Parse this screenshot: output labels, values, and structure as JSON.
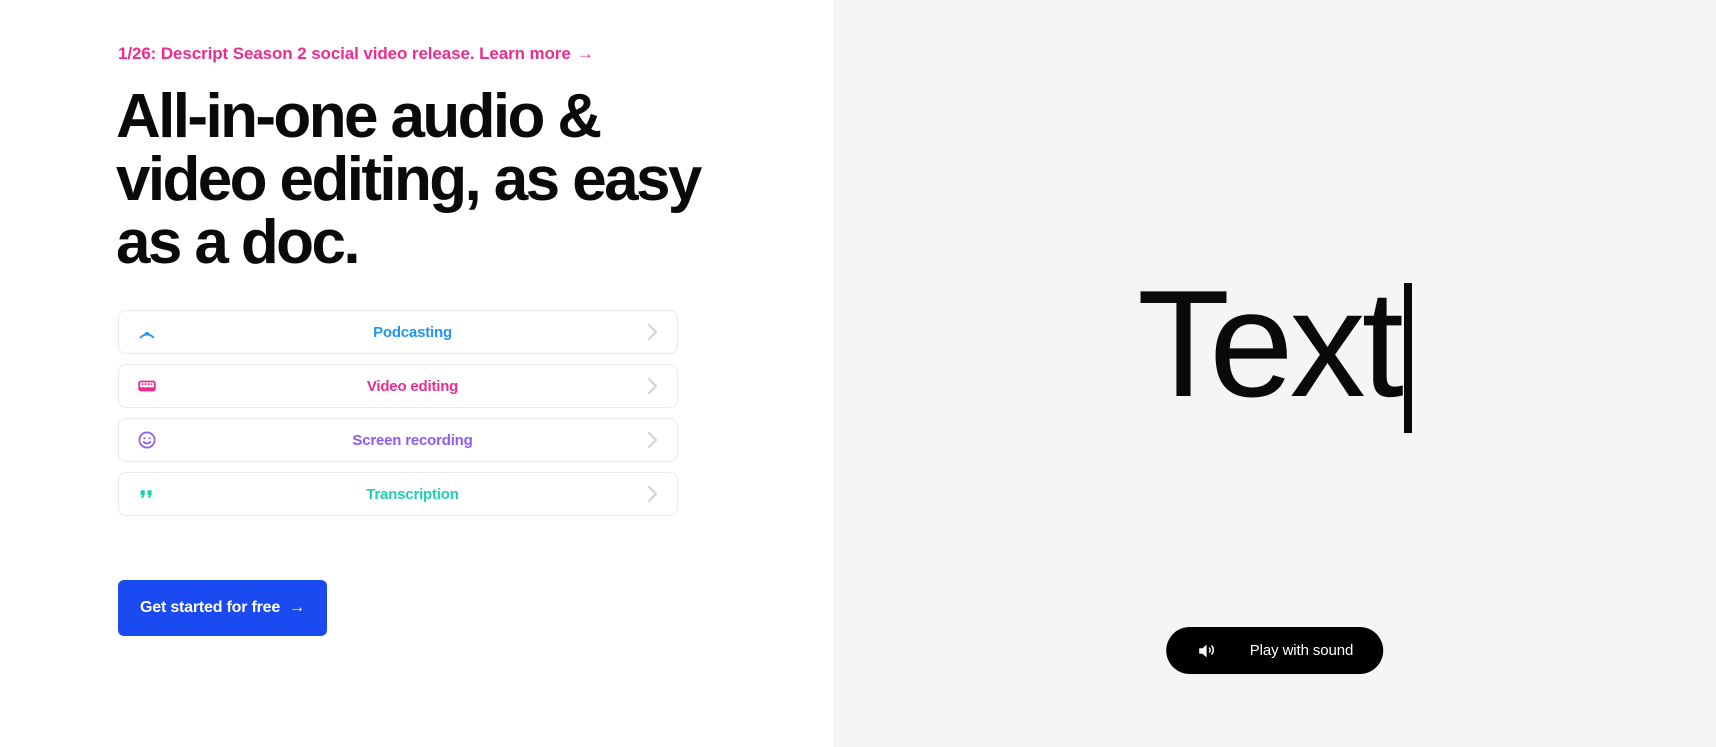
{
  "announcement": {
    "text": "1/26: Descript Season 2 social video release. Learn more",
    "arrow": "→",
    "color": "#EC2C8F"
  },
  "headline": "All-in-one audio & video editing, as easy as a doc.",
  "features": [
    {
      "label": "Podcasting",
      "color": "#2196F3",
      "icon": "podcast-icon"
    },
    {
      "label": "Video editing",
      "color": "#EC2C8F",
      "icon": "film-strip-icon"
    },
    {
      "label": "Screen recording",
      "color": "#8B5CF6",
      "icon": "smiley-face-icon"
    },
    {
      "label": "Transcription",
      "color": "#1ECFB0",
      "icon": "quote-marks-icon"
    }
  ],
  "cta": {
    "label": "Get started for free",
    "arrow": "→",
    "color": "#1B4AF0"
  },
  "preview": {
    "word": "Text",
    "caret": "|",
    "background": "#F5F5F5"
  },
  "sound_button": {
    "label": "Play with sound",
    "icon": "speaker-wave-icon",
    "background": "#000000"
  }
}
